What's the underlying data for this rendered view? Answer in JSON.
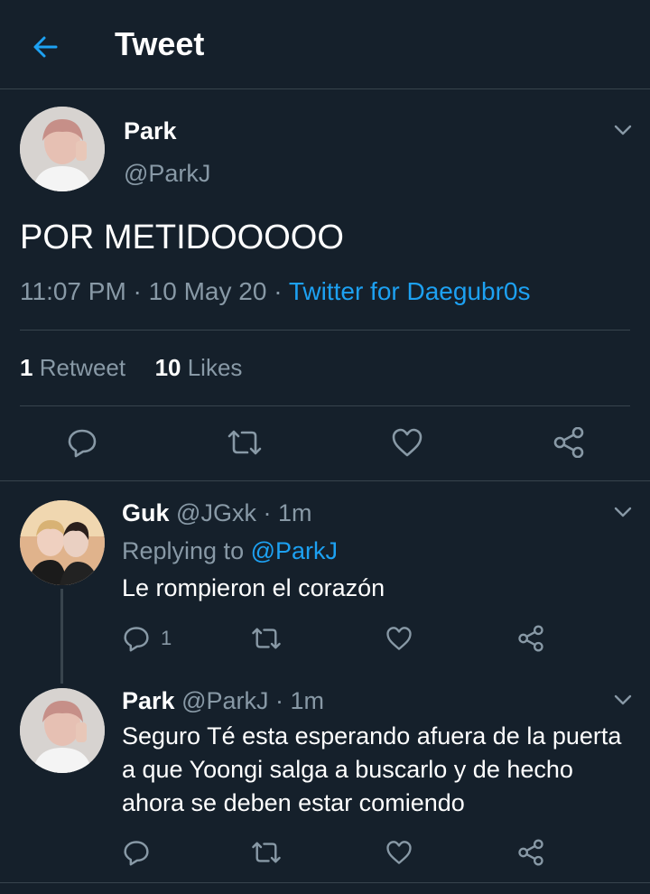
{
  "header": {
    "title": "Tweet"
  },
  "main_tweet": {
    "name": "Park",
    "handle": "@ParkJ",
    "text": "POR METIDOOOOO",
    "time": "11:07 PM",
    "date": "10 May 20",
    "source": "Twitter for Daegubr0s",
    "retweets": "1",
    "retweets_label": "Retweet",
    "likes": "10",
    "likes_label": "Likes"
  },
  "replies": [
    {
      "name": "Guk",
      "handle": "@JGxk",
      "time": "1m",
      "replying_label": "Replying to",
      "replying_to": "@ParkJ",
      "text": "Le rompieron el corazón",
      "reply_count": "1"
    },
    {
      "name": "Park",
      "handle": "@ParkJ",
      "time": "1m",
      "text": "Seguro Té esta esperando afuera de la puerta a que Yoongi salga a buscarlo y de hecho ahora se deben estar comiendo"
    }
  ],
  "colors": {
    "background": "#15202b",
    "accent": "#1da1f2",
    "muted": "#8899a6",
    "divider": "#38444d"
  },
  "icons": [
    "back-arrow-icon",
    "chevron-down-icon",
    "reply-icon",
    "retweet-icon",
    "like-icon",
    "share-icon"
  ]
}
